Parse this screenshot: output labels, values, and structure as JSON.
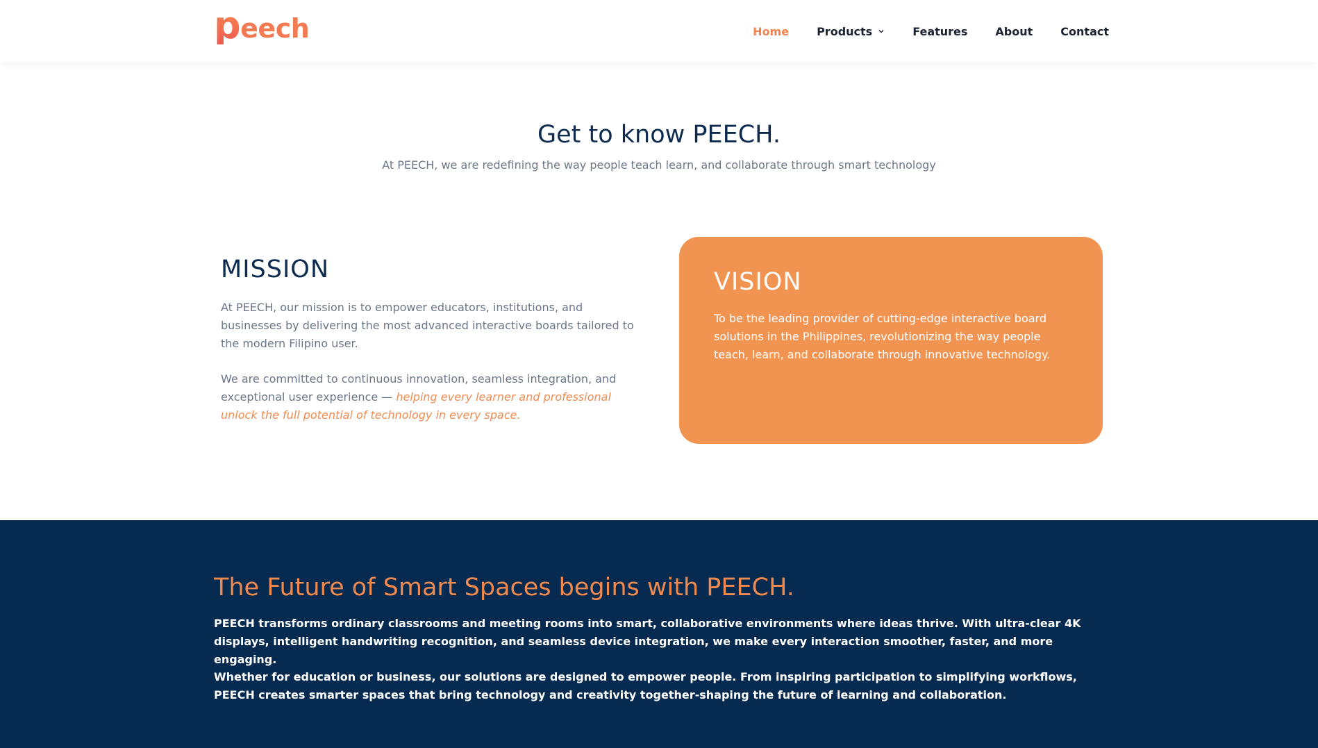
{
  "header": {
    "logo": {
      "text": "peech"
    },
    "nav": [
      {
        "label": "Home",
        "active": true
      },
      {
        "label": "Products",
        "has_dropdown": true
      },
      {
        "label": "Features"
      },
      {
        "label": "About"
      },
      {
        "label": "Contact"
      }
    ]
  },
  "intro": {
    "title": "Get to know PEECH.",
    "subtitle": "At PEECH, we are redefining the way people teach learn, and collaborate through smart technology"
  },
  "mission": {
    "heading": "MISSION",
    "paragraph1": "At PEECH, our mission is to empower educators, institutions, and businesses by delivering the most advanced interactive boards tailored to the modern Filipino user.",
    "paragraph2_plain": "We are committed to continuous innovation, seamless integration, and exceptional user experience — ",
    "paragraph2_accent": "helping every learner and professional unlock the full potential of technology in every space."
  },
  "vision": {
    "heading": "VISION",
    "text": "To be the leading provider of cutting-edge interactive board solutions in the Philippines, revolutionizing the way people teach, learn, and collaborate through innovative technology."
  },
  "future": {
    "title": "The Future of Smart Spaces begins with PEECH.",
    "paragraph1": "PEECH transforms ordinary classrooms and meeting rooms into smart, collaborative environments where ideas thrive. With ultra-clear 4K displays, intelligent handwriting recognition, and seamless device integration, we make every interaction smoother, faster, and more engaging.",
    "paragraph2": "Whether for education or business, our solutions are designed to empower people. From inspiring participation to simplifying workflows, PEECH creates smarter spaces that bring technology and creativity together-shaping the future of learning and collaboration."
  },
  "colors": {
    "accent_orange": "#f0834e",
    "vision_card": "#f19452",
    "navy": "#062a50",
    "heading_navy": "#0d2b4e",
    "body_gray": "#6b7788"
  }
}
